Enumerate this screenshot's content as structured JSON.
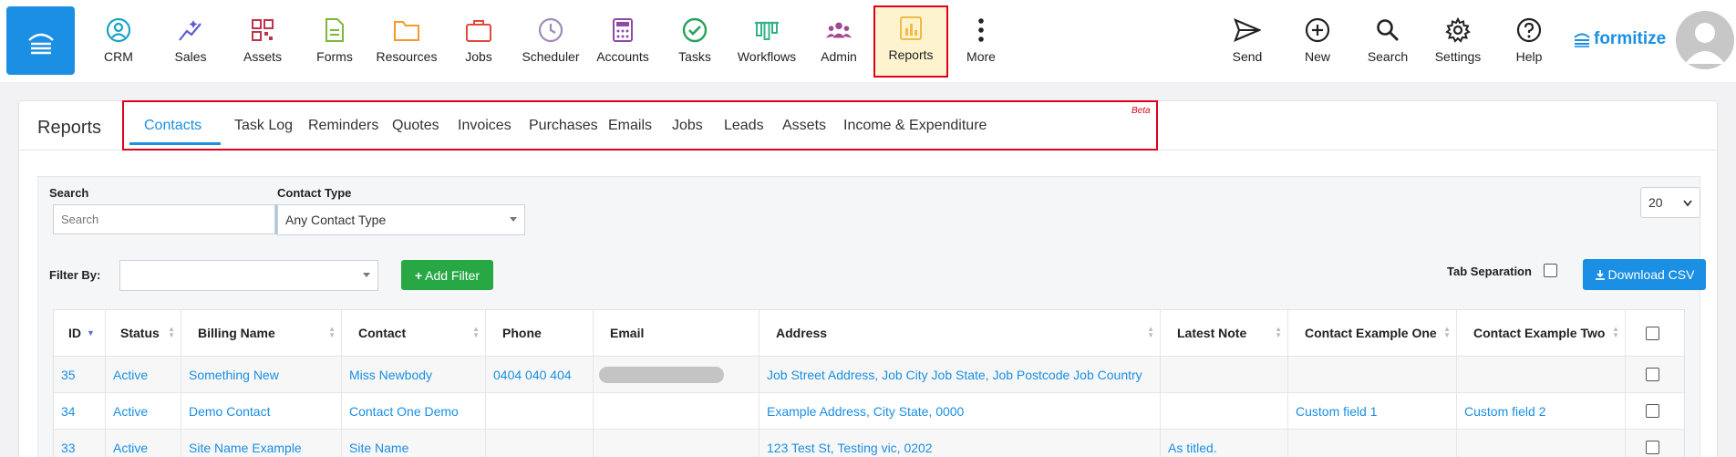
{
  "nav": {
    "items": [
      {
        "label": "CRM",
        "icon": "crm-icon",
        "color": "#19a3c6"
      },
      {
        "label": "Sales",
        "icon": "sales-icon",
        "color": "#5b5bd6"
      },
      {
        "label": "Assets",
        "icon": "assets-icon",
        "color": "#c0334d"
      },
      {
        "label": "Forms",
        "icon": "forms-icon",
        "color": "#7ab93a"
      },
      {
        "label": "Resources",
        "icon": "resources-icon",
        "color": "#f39a2b"
      },
      {
        "label": "Jobs",
        "icon": "jobs-icon",
        "color": "#e04a3a"
      },
      {
        "label": "Scheduler",
        "icon": "scheduler-icon",
        "color": "#9f8ab8"
      },
      {
        "label": "Accounts",
        "icon": "accounts-icon",
        "color": "#8f4aa8"
      },
      {
        "label": "Tasks",
        "icon": "tasks-icon",
        "color": "#27a35a"
      },
      {
        "label": "Workflows",
        "icon": "workflows-icon",
        "color": "#33b28a"
      },
      {
        "label": "Admin",
        "icon": "admin-icon",
        "color": "#a3478e"
      },
      {
        "label": "Reports",
        "icon": "reports-icon",
        "color": "#f4b942"
      },
      {
        "label": "More",
        "icon": "more-icon",
        "color": "#222222"
      }
    ],
    "right_items": [
      {
        "label": "Send",
        "icon": "send-icon"
      },
      {
        "label": "New",
        "icon": "plus-circle-icon"
      },
      {
        "label": "Search",
        "icon": "search-icon"
      },
      {
        "label": "Settings",
        "icon": "gear-icon"
      },
      {
        "label": "Help",
        "icon": "help-icon"
      }
    ],
    "logo": "formitize"
  },
  "page": {
    "title": "Reports",
    "tabs": [
      "Contacts",
      "Task Log",
      "Reminders",
      "Quotes",
      "Invoices",
      "Purchases",
      "Emails",
      "Jobs",
      "Leads",
      "Assets",
      "Income & Expenditure"
    ],
    "active_tab": "Contacts",
    "beta_label": "Beta"
  },
  "filters": {
    "search_label": "Search",
    "search_placeholder": "Search",
    "contact_type_label": "Contact Type",
    "contact_type_value": "Any Contact Type",
    "page_size": "20",
    "filter_by_label": "Filter By:",
    "add_filter_label": "Add Filter",
    "tab_separation_label": "Tab Separation",
    "download_csv_label": "Download CSV"
  },
  "table": {
    "headers": [
      "ID",
      "Status",
      "Billing Name",
      "Contact",
      "Phone",
      "Email",
      "Address",
      "Latest Note",
      "Contact Example One",
      "Contact Example Two"
    ],
    "rows": [
      {
        "id": "35",
        "status": "Active",
        "billing_name": "Something New",
        "contact": "Miss Newbody",
        "phone": "0404 040 404",
        "email_redacted": true,
        "address": "Job Street Address, Job City Job State, Job Postcode Job Country",
        "note": "",
        "ex1": "",
        "ex2": ""
      },
      {
        "id": "34",
        "status": "Active",
        "billing_name": "Demo Contact",
        "contact": "Contact One Demo",
        "phone": "",
        "email_redacted": false,
        "address": "Example Address, City State, 0000",
        "note": "",
        "ex1": "Custom field 1",
        "ex2": "Custom field 2"
      },
      {
        "id": "33",
        "status": "Active",
        "billing_name": "Site Name Example",
        "contact": "Site Name",
        "phone": "",
        "email_redacted": false,
        "address": "123 Test St, Testing vic, 0202",
        "note": "As titled.",
        "ex1": "",
        "ex2": ""
      }
    ]
  },
  "colors": {
    "accent": "#1a8fe3",
    "highlight": "#e0001b",
    "success": "#28a745"
  }
}
